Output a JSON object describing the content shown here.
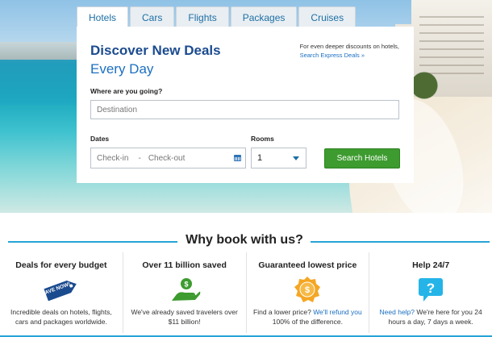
{
  "tabs": [
    "Hotels",
    "Cars",
    "Flights",
    "Packages",
    "Cruises"
  ],
  "search": {
    "title_line1": "Discover New Deals",
    "title_line2": "Every Day",
    "promo_text": "For even deeper discounts on hotels,",
    "promo_link": "Search Express Deals »",
    "where_label": "Where are you going?",
    "destination_placeholder": "Destination",
    "dates_label": "Dates",
    "checkin_placeholder": "Check-in",
    "date_separator": "-",
    "checkout_placeholder": "Check-out",
    "rooms_label": "Rooms",
    "rooms_value": "1",
    "search_button": "Search Hotels"
  },
  "why": {
    "heading": "Why book with us?",
    "features": [
      {
        "title": "Deals for every budget",
        "icon": "save-now-tag-icon",
        "icon_text": "SAVE NOW!",
        "text": "Incredible deals on hotels, flights, cars and packages worldwide."
      },
      {
        "title": "Over 11 billion saved",
        "icon": "hand-money-icon",
        "text": "We've already saved travelers over $11 billion!"
      },
      {
        "title": "Guaranteed lowest price",
        "icon": "price-badge-icon",
        "text_before": "Find a lower price? ",
        "link": "We'll refund you",
        "text_after": " 100% of the difference."
      },
      {
        "title": "Help 24/7",
        "icon": "help-chat-icon",
        "link": "Need help?",
        "text_after": " We're here for you 24 hours a day, 7 days a week."
      }
    ]
  },
  "colors": {
    "accent_blue": "#27a3d6",
    "title_blue": "#1b4b8f",
    "button_green": "#3d9b2f",
    "icon_green": "#3d9b2f",
    "icon_orange": "#f5a623",
    "icon_navy": "#1b4b8f",
    "icon_cyan": "#25b4e8"
  }
}
